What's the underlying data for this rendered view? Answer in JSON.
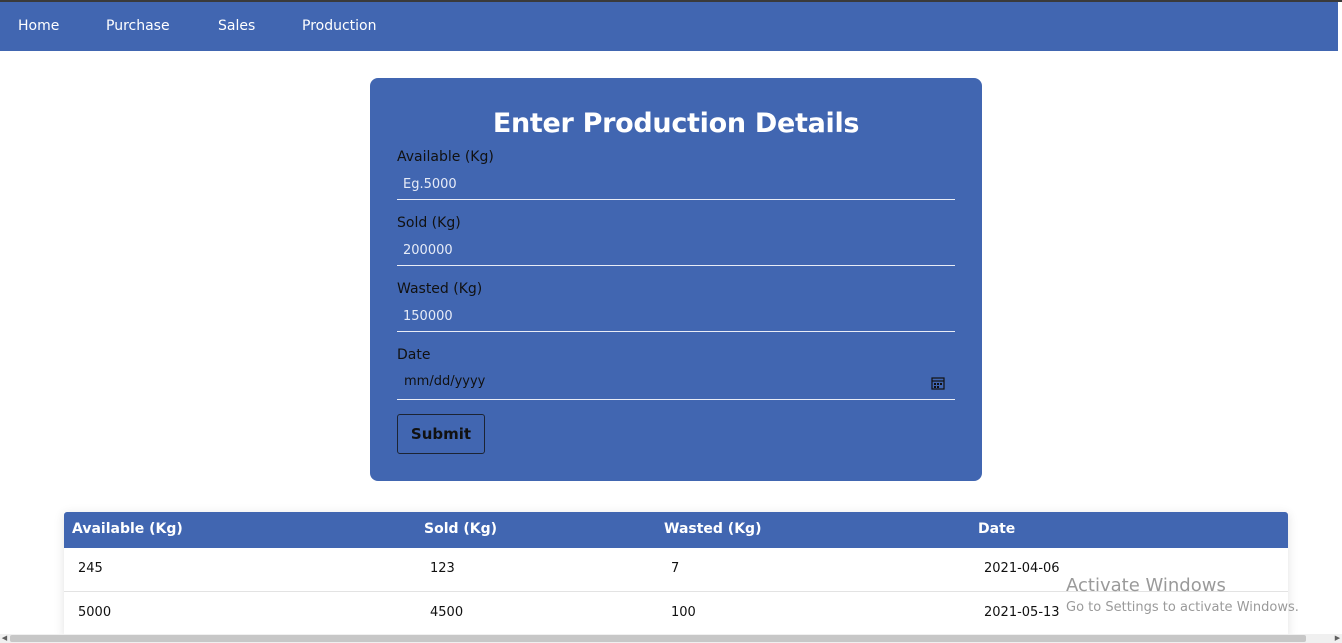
{
  "nav": {
    "items": [
      {
        "label": "Home"
      },
      {
        "label": "Purchase"
      },
      {
        "label": "Sales"
      },
      {
        "label": "Production"
      }
    ]
  },
  "form": {
    "title": "Enter Production Details",
    "fields": [
      {
        "label": "Available (Kg)",
        "placeholder": "Eg.5000"
      },
      {
        "label": "Sold (Kg)",
        "placeholder": "200000"
      },
      {
        "label": "Wasted (Kg)",
        "placeholder": "150000"
      },
      {
        "label": "Date",
        "value": "mm/dd/yyyy"
      }
    ],
    "submit_label": "Submit"
  },
  "table": {
    "headers": [
      "Available (Kg)",
      "Sold (Kg)",
      "Wasted (Kg)",
      "Date"
    ],
    "rows": [
      [
        "245",
        "123",
        "7",
        "2021-04-06"
      ],
      [
        "5000",
        "4500",
        "100",
        "2021-05-13"
      ]
    ]
  },
  "watermark": {
    "title": "Activate Windows",
    "subtitle": "Go to Settings to activate Windows."
  },
  "colors": {
    "accent": "#4166b1"
  }
}
